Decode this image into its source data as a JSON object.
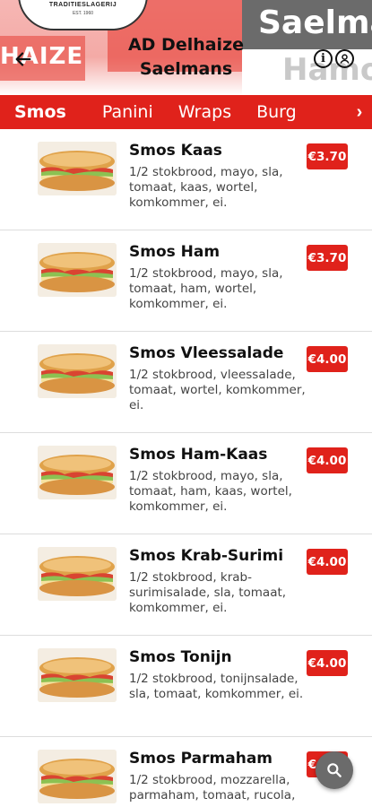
{
  "header": {
    "store_title": "AD Delhaize Saelmans",
    "brand_badge_tag": "TRADITIESLAGERIJ",
    "brand_badge_sub": "EST. 1960",
    "bg_logo_text": "HAIZE",
    "bg_word_1": "Saelma",
    "bg_word_2": "Hamo",
    "back_icon": "arrow-left-icon",
    "info_icon": "info-icon",
    "profile_icon": "user-icon",
    "info_glyph": "i"
  },
  "tabs": {
    "items": [
      {
        "label": "Smos",
        "active": true
      },
      {
        "label": "Panini",
        "active": false
      },
      {
        "label": "Wraps",
        "active": false
      },
      {
        "label": "Burg",
        "active": false
      }
    ],
    "next_glyph": "›",
    "next_icon": "chevron-right-icon"
  },
  "products": [
    {
      "name": "Smos Kaas",
      "description": "1/2 stokbrood, mayo, sla, tomaat, kaas, wortel, komkommer, ei.",
      "price": "€3.70"
    },
    {
      "name": "Smos Ham",
      "description": "1/2 stokbrood, mayo, sla, tomaat, ham, wortel, komkommer, ei.",
      "price": "€3.70"
    },
    {
      "name": "Smos Vleessalade",
      "description": "1/2 stokbrood, vleessalade, tomaat, wortel, komkommer, ei.",
      "price": "€4.00"
    },
    {
      "name": "Smos Ham-Kaas",
      "description": "1/2 stokbrood, mayo, sla, tomaat, ham, kaas, wortel, komkommer, ei.",
      "price": "€4.00"
    },
    {
      "name": "Smos Krab-Surimi",
      "description": "1/2 stokbrood, krab-surimisalade, sla, tomaat, komkommer, ei.",
      "price": "€4.00"
    },
    {
      "name": "Smos Tonijn",
      "description": "1/2 stokbrood, tonijnsalade, sla, tomaat, komkommer, ei.",
      "price": "€4.00"
    },
    {
      "name": "Smos Parmaham",
      "description": "1/2 stokbrood, mozzarella, parmaham, tomaat, rucola,",
      "price": "€4.50"
    }
  ],
  "search_fab": {
    "icon": "search-icon"
  },
  "colors": {
    "accent": "#e0221b",
    "fab": "#6b6b6b",
    "text": "#111111"
  }
}
